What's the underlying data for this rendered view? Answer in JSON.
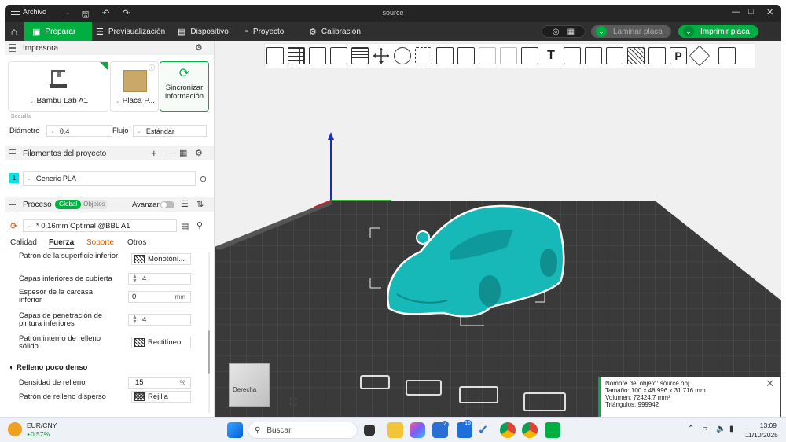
{
  "titlebar": {
    "menu_label": "Archivo",
    "window_title": "source",
    "minimize": "—",
    "maximize": "□",
    "close": "✕"
  },
  "nav": {
    "tabs": [
      {
        "label": "Preparar",
        "icon": "cube-icon",
        "active": true
      },
      {
        "label": "Previsualización",
        "icon": "layers-icon"
      },
      {
        "label": "Dispositivo",
        "icon": "device-icon"
      },
      {
        "label": "Proyecto",
        "icon": "project-icon"
      },
      {
        "label": "Calibración",
        "icon": "gear-icon"
      }
    ],
    "slice_label": "Laminar placa",
    "print_label": "Imprimir placa"
  },
  "printer_section": {
    "title": "Impresora",
    "printer_name": "Bambu Lab A1",
    "plate_name": "Placa P...",
    "sync_label_1": "Sincronizar",
    "sync_label_2": "información",
    "nozzle_label": "Boquilla",
    "diameter_label": "Diámetro",
    "diameter_value": "0.4",
    "flow_label": "Flujo",
    "flow_value": "Estándar"
  },
  "filament_section": {
    "title": "Filamentos del proyecto",
    "items": [
      {
        "index": "1",
        "name": "Generic PLA",
        "color": "#00e5e5"
      }
    ]
  },
  "process_section": {
    "title": "Proceso",
    "toggle_global": "Global",
    "toggle_objects": "Objetos",
    "advanced_label": "Avanzar",
    "preset": "* 0.16mm Optimal @BBL A1",
    "tabs": [
      "Calidad",
      "Fuerza",
      "Soporte",
      "Otros"
    ],
    "active_tab": "Fuerza",
    "rows": {
      "top_surface_pattern_label": "Patrón de la superficie inferior",
      "top_surface_pattern_value": "Monotóni...",
      "bottom_shell_layers_label": "Capas inferiores de cubierta",
      "bottom_shell_layers_value": "4",
      "bottom_shell_thickness_label": "Espesor de la carcasa inferior",
      "bottom_shell_thickness_value": "0",
      "bottom_shell_thickness_unit": "mm",
      "bottom_paint_layers_label": "Capas de penetración de pintura inferiores",
      "bottom_paint_layers_value": "4",
      "solid_infill_pattern_label": "Patrón interno de relleno sólido",
      "solid_infill_pattern_value": "Rectilíneo",
      "sparse_infill_header": "Relleno poco denso",
      "infill_density_label": "Densidad de relleno",
      "infill_density_value": "15",
      "infill_density_unit": "%",
      "sparse_pattern_label": "Patrón de relleno disperso",
      "sparse_pattern_value": "Rejilla"
    }
  },
  "viewport": {
    "view_cube_label": "Derecha",
    "object_color": "#17b8b8",
    "bed_color": "#3a3a3a",
    "info": {
      "name": "Nombre del objeto: source.obj",
      "size": "Tamaño: 100 x 48.996 x 31.716 mm",
      "volume": "Volumen: 72424.7 mm³",
      "triangles": "Triángulos: 999942"
    }
  },
  "taskbar": {
    "widget_title": "EUR/CNY",
    "widget_value": "+0,57%",
    "search_placeholder": "Buscar",
    "time": "13:09",
    "date": "11/10/2025",
    "badge_1": "2",
    "badge_2": "16"
  }
}
